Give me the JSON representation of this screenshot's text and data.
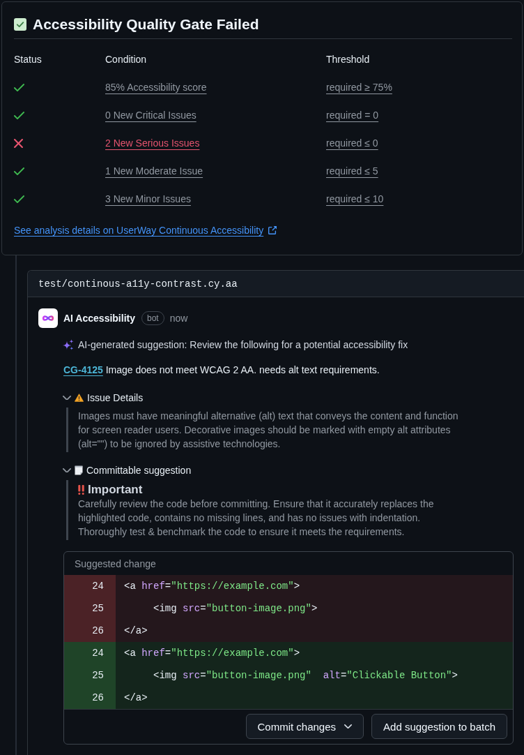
{
  "quality_gate": {
    "title": "Accessibility Quality Gate Failed",
    "columns": [
      "Status",
      "Condition",
      "Threshold"
    ],
    "conditions": [
      {
        "passed": true,
        "condition": "85% Accessibility score",
        "threshold": "required ≥ 75%"
      },
      {
        "passed": true,
        "condition": "0 New Critical Issues",
        "threshold": "required = 0"
      },
      {
        "passed": false,
        "condition": "2 New Serious Issues",
        "threshold": "required ≤ 0"
      },
      {
        "passed": true,
        "condition": "1 New Moderate Issue",
        "threshold": "required ≤ 5"
      },
      {
        "passed": true,
        "condition": "3 New Minor Issues",
        "threshold": "required ≤ 10"
      }
    ],
    "details_link": "See analysis details on UserWay Continuous Accessibility"
  },
  "review": {
    "file_path": "test/continous-a11y-contrast.cy.aa",
    "comment": {
      "author": "AI Accessibility",
      "badge": "bot",
      "time": "now",
      "intro": "AI-generated suggestion: Review the following for a potential accessibility fix",
      "issue_id": "CG-4125",
      "issue_text": "Image does not meet WCAG 2 AA. needs alt text requirements.",
      "sections": [
        {
          "kind": "details",
          "title": "Issue Details",
          "expanded": true,
          "body": "Images must have meaningful alternative (alt) text that conveys the content and function for screen reader users. Decorative images should be marked with empty alt attributes (alt=\"\") to be ignored by assistive technologies."
        },
        {
          "kind": "suggestion",
          "title": "Committable suggestion",
          "expanded": true,
          "heading": "Important",
          "body": "Carefully review the code before committing. Ensure that it accurately replaces the highlighted code, contains no missing lines, and has no issues with indentation. Thoroughly test & benchmark the code to ensure it meets the requirements."
        }
      ],
      "suggested_change": {
        "title": "Suggested change",
        "lines": [
          {
            "kind": "deleted",
            "number": "24",
            "tokens": [
              {
                "kind": "plain",
                "text": "<a "
              },
              {
                "kind": "attr",
                "text": "href"
              },
              {
                "kind": "plain",
                "text": "="
              },
              {
                "kind": "string",
                "text": "\"https://example.com\""
              },
              {
                "kind": "plain",
                "text": ">"
              }
            ]
          },
          {
            "kind": "deleted",
            "number": "25",
            "tokens": [
              {
                "kind": "plain",
                "text": "     <img "
              },
              {
                "kind": "attr",
                "text": "src"
              },
              {
                "kind": "plain",
                "text": "="
              },
              {
                "kind": "string",
                "text": "\"button-image.png\""
              },
              {
                "kind": "plain",
                "text": ">"
              }
            ]
          },
          {
            "kind": "deleted",
            "number": "26",
            "tokens": [
              {
                "kind": "plain",
                "text": "</a>"
              }
            ]
          },
          {
            "kind": "added",
            "number": "24",
            "tokens": [
              {
                "kind": "plain",
                "text": "<a "
              },
              {
                "kind": "attr",
                "text": "href"
              },
              {
                "kind": "plain",
                "text": "="
              },
              {
                "kind": "string",
                "text": "\"https://example.com\""
              },
              {
                "kind": "plain",
                "text": ">"
              }
            ]
          },
          {
            "kind": "added",
            "number": "25",
            "tokens": [
              {
                "kind": "plain",
                "text": "     <img "
              },
              {
                "kind": "attr",
                "text": "src"
              },
              {
                "kind": "plain",
                "text": "="
              },
              {
                "kind": "string",
                "text": "\"button-image.png\"  "
              },
              {
                "kind": "attr",
                "text": "alt"
              },
              {
                "kind": "plain",
                "text": "="
              },
              {
                "kind": "string",
                "text": "\"Clickable Button\""
              },
              {
                "kind": "plain",
                "text": ">"
              }
            ]
          },
          {
            "kind": "added",
            "number": "26",
            "tokens": [
              {
                "kind": "plain",
                "text": "</a>"
              }
            ]
          }
        ],
        "buttons": [
          {
            "kind": "dropdown",
            "label": "Commit changes"
          },
          {
            "kind": "plain",
            "label": "Add suggestion to batch"
          }
        ]
      }
    }
  }
}
